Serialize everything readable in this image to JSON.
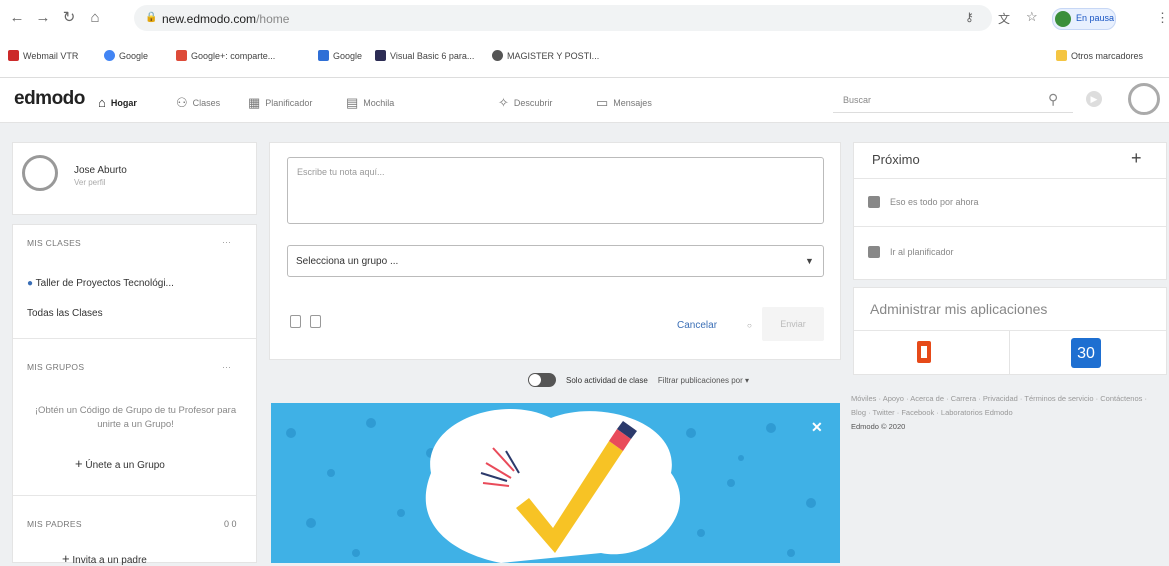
{
  "browser": {
    "url_host": "new.edmodo.com",
    "url_path": "/home",
    "profile_status": "En pausa",
    "bookmarks": [
      {
        "label": "Webmail VTR",
        "color": "#cc2a2a"
      },
      {
        "label": "Google",
        "color": "#4285f4"
      },
      {
        "label": "Google+: comparte...",
        "color": "#dd4b39"
      },
      {
        "label": "Google",
        "color": "#2f6fd6"
      },
      {
        "label": "Visual Basic 6 para...",
        "color": "#2c2c54"
      },
      {
        "label": "MAGISTER Y POSTI...",
        "color": "#555555"
      }
    ],
    "other_bookmarks": "Otros marcadores"
  },
  "nav": {
    "logo": "edmodo",
    "items": [
      {
        "label": "Hogar",
        "icon": "home-icon"
      },
      {
        "label": "Clases",
        "icon": "classes-icon"
      },
      {
        "label": "Planificador",
        "icon": "planner-icon"
      },
      {
        "label": "Mochila",
        "icon": "backpack-icon"
      },
      {
        "label": "Descubrir",
        "icon": "discover-icon"
      },
      {
        "label": "Mensajes",
        "icon": "messages-icon"
      }
    ],
    "search_placeholder": "Buscar"
  },
  "profile": {
    "name": "Jose Aburto",
    "view_profile": "Ver perfil"
  },
  "sidebar": {
    "classes_title": "MIS CLASES",
    "classes_more": "···",
    "class_item": "Taller de Proyectos Tecnológi...",
    "all_classes": "Todas las Clases",
    "groups_title": "MIS GRUPOS",
    "groups_more": "···",
    "groups_text": "¡Obtén un Código de Grupo de tu Profesor para unirte a un Grupo!",
    "join_group": "Únete a un Grupo",
    "parents_title": "MIS PADRES",
    "parents_count": "0 0",
    "invite_parent": "Invita a un padre"
  },
  "composer": {
    "note_placeholder": "Escribe tu nota aquí...",
    "group_select": "Selecciona un grupo ...",
    "cancel": "Cancelar",
    "send": "Enviar"
  },
  "feed": {
    "class_activity_toggle": "Solo actividad de clase",
    "filter": "Filtrar publicaciones por"
  },
  "upcoming": {
    "title": "Próximo",
    "empty": "Eso es todo por ahora",
    "planner_link": "Ir al planificador"
  },
  "apps": {
    "title": "Administrar mis aplicaciones",
    "calendar_day": "30",
    "office_color": "#e64a19",
    "calendar_color": "#1e6fd1"
  },
  "footer": {
    "links": [
      "Móviles",
      "Apoyo",
      "Acerca de",
      "Carrera",
      "Privacidad",
      "Términos de servicio",
      "Contáctenos",
      "Blog",
      "Twitter",
      "Facebook",
      "Laboratorios Edmodo"
    ],
    "copyright": "Edmodo © 2020"
  }
}
